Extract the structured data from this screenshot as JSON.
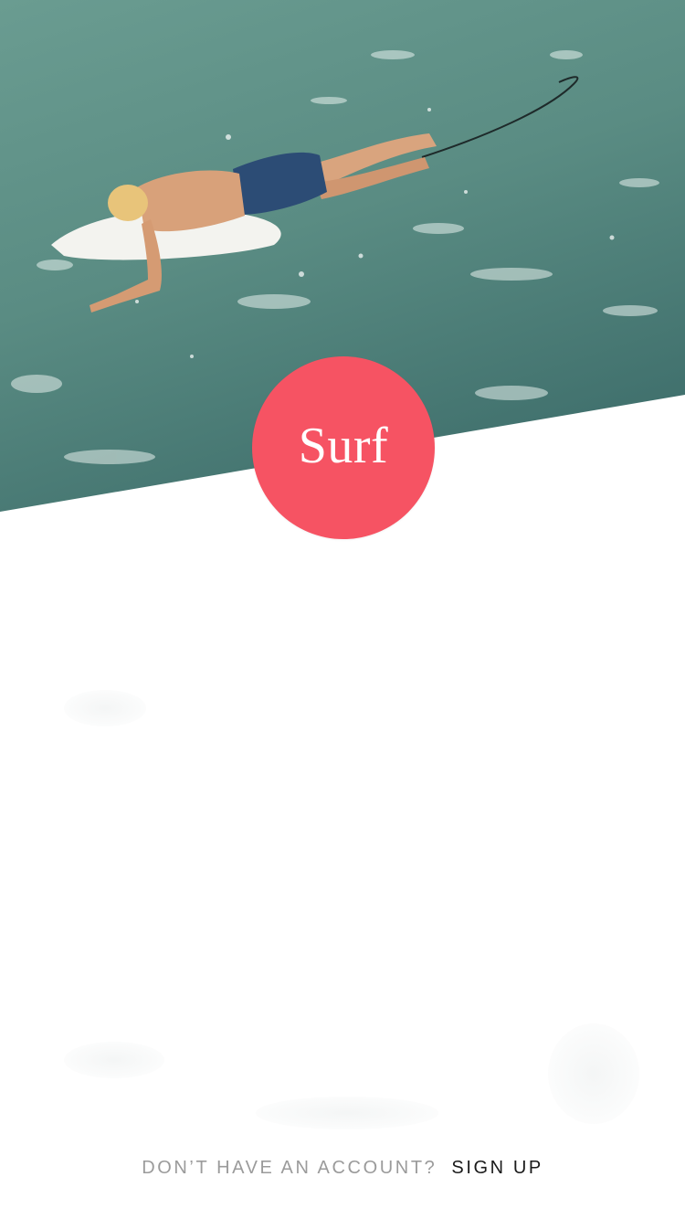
{
  "hero": {
    "image_alt": "surfer paddling on a surfboard in the ocean"
  },
  "logo": {
    "text": "Surf",
    "color": "#f65363"
  },
  "footer": {
    "prompt": "DON’T HAVE AN ACCOUNT?",
    "signup_label": "SIGN UP"
  },
  "colors": {
    "water": "#5e8f86",
    "water_dark": "#3e6e69",
    "accent": "#f65363"
  }
}
